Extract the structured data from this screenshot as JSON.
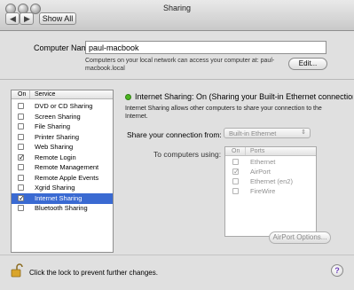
{
  "window": {
    "title": "Sharing"
  },
  "toolbar": {
    "show_all_label": "Show All",
    "back_icon": "◀",
    "forward_icon": "▶"
  },
  "computer_name": {
    "label": "Computer Name:",
    "value": "paul-macbook",
    "hint_line1": "Computers on your local network can access your computer at: paul-",
    "hint_line2": "macbook.local",
    "edit_label": "Edit..."
  },
  "services": {
    "col_on": "On",
    "col_service": "Service",
    "items": [
      {
        "label": "DVD or CD Sharing",
        "checked": false,
        "selected": false
      },
      {
        "label": "Screen Sharing",
        "checked": false,
        "selected": false
      },
      {
        "label": "File Sharing",
        "checked": false,
        "selected": false
      },
      {
        "label": "Printer Sharing",
        "checked": false,
        "selected": false
      },
      {
        "label": "Web Sharing",
        "checked": false,
        "selected": false
      },
      {
        "label": "Remote Login",
        "checked": true,
        "selected": false
      },
      {
        "label": "Remote Management",
        "checked": false,
        "selected": false
      },
      {
        "label": "Remote Apple Events",
        "checked": false,
        "selected": false
      },
      {
        "label": "Xgrid Sharing",
        "checked": false,
        "selected": false
      },
      {
        "label": "Internet Sharing",
        "checked": true,
        "selected": true
      },
      {
        "label": "Bluetooth Sharing",
        "checked": false,
        "selected": false
      }
    ]
  },
  "status": {
    "text": "Internet Sharing: On (Sharing your Built-in Ethernet connection)",
    "desc_line1": "Internet Sharing allows other computers to share your connection to the",
    "desc_line2": "Internet.",
    "indicator_color": "#4cb521"
  },
  "share_from": {
    "label": "Share your connection from:",
    "value": "Built-in Ethernet"
  },
  "to_computers": {
    "label": "To computers using:",
    "col_on": "On",
    "col_ports": "Ports",
    "items": [
      {
        "label": "Ethernet",
        "checked": false
      },
      {
        "label": "AirPort",
        "checked": true
      },
      {
        "label": "Ethernet (en2)",
        "checked": false
      },
      {
        "label": "FireWire",
        "checked": false
      }
    ]
  },
  "airport_options_label": "AirPort Options...",
  "lock": {
    "text": "Click the lock to prevent further changes."
  },
  "help_glyph": "?",
  "check_glyph": "✓",
  "selection_color": "#3a6ad2"
}
